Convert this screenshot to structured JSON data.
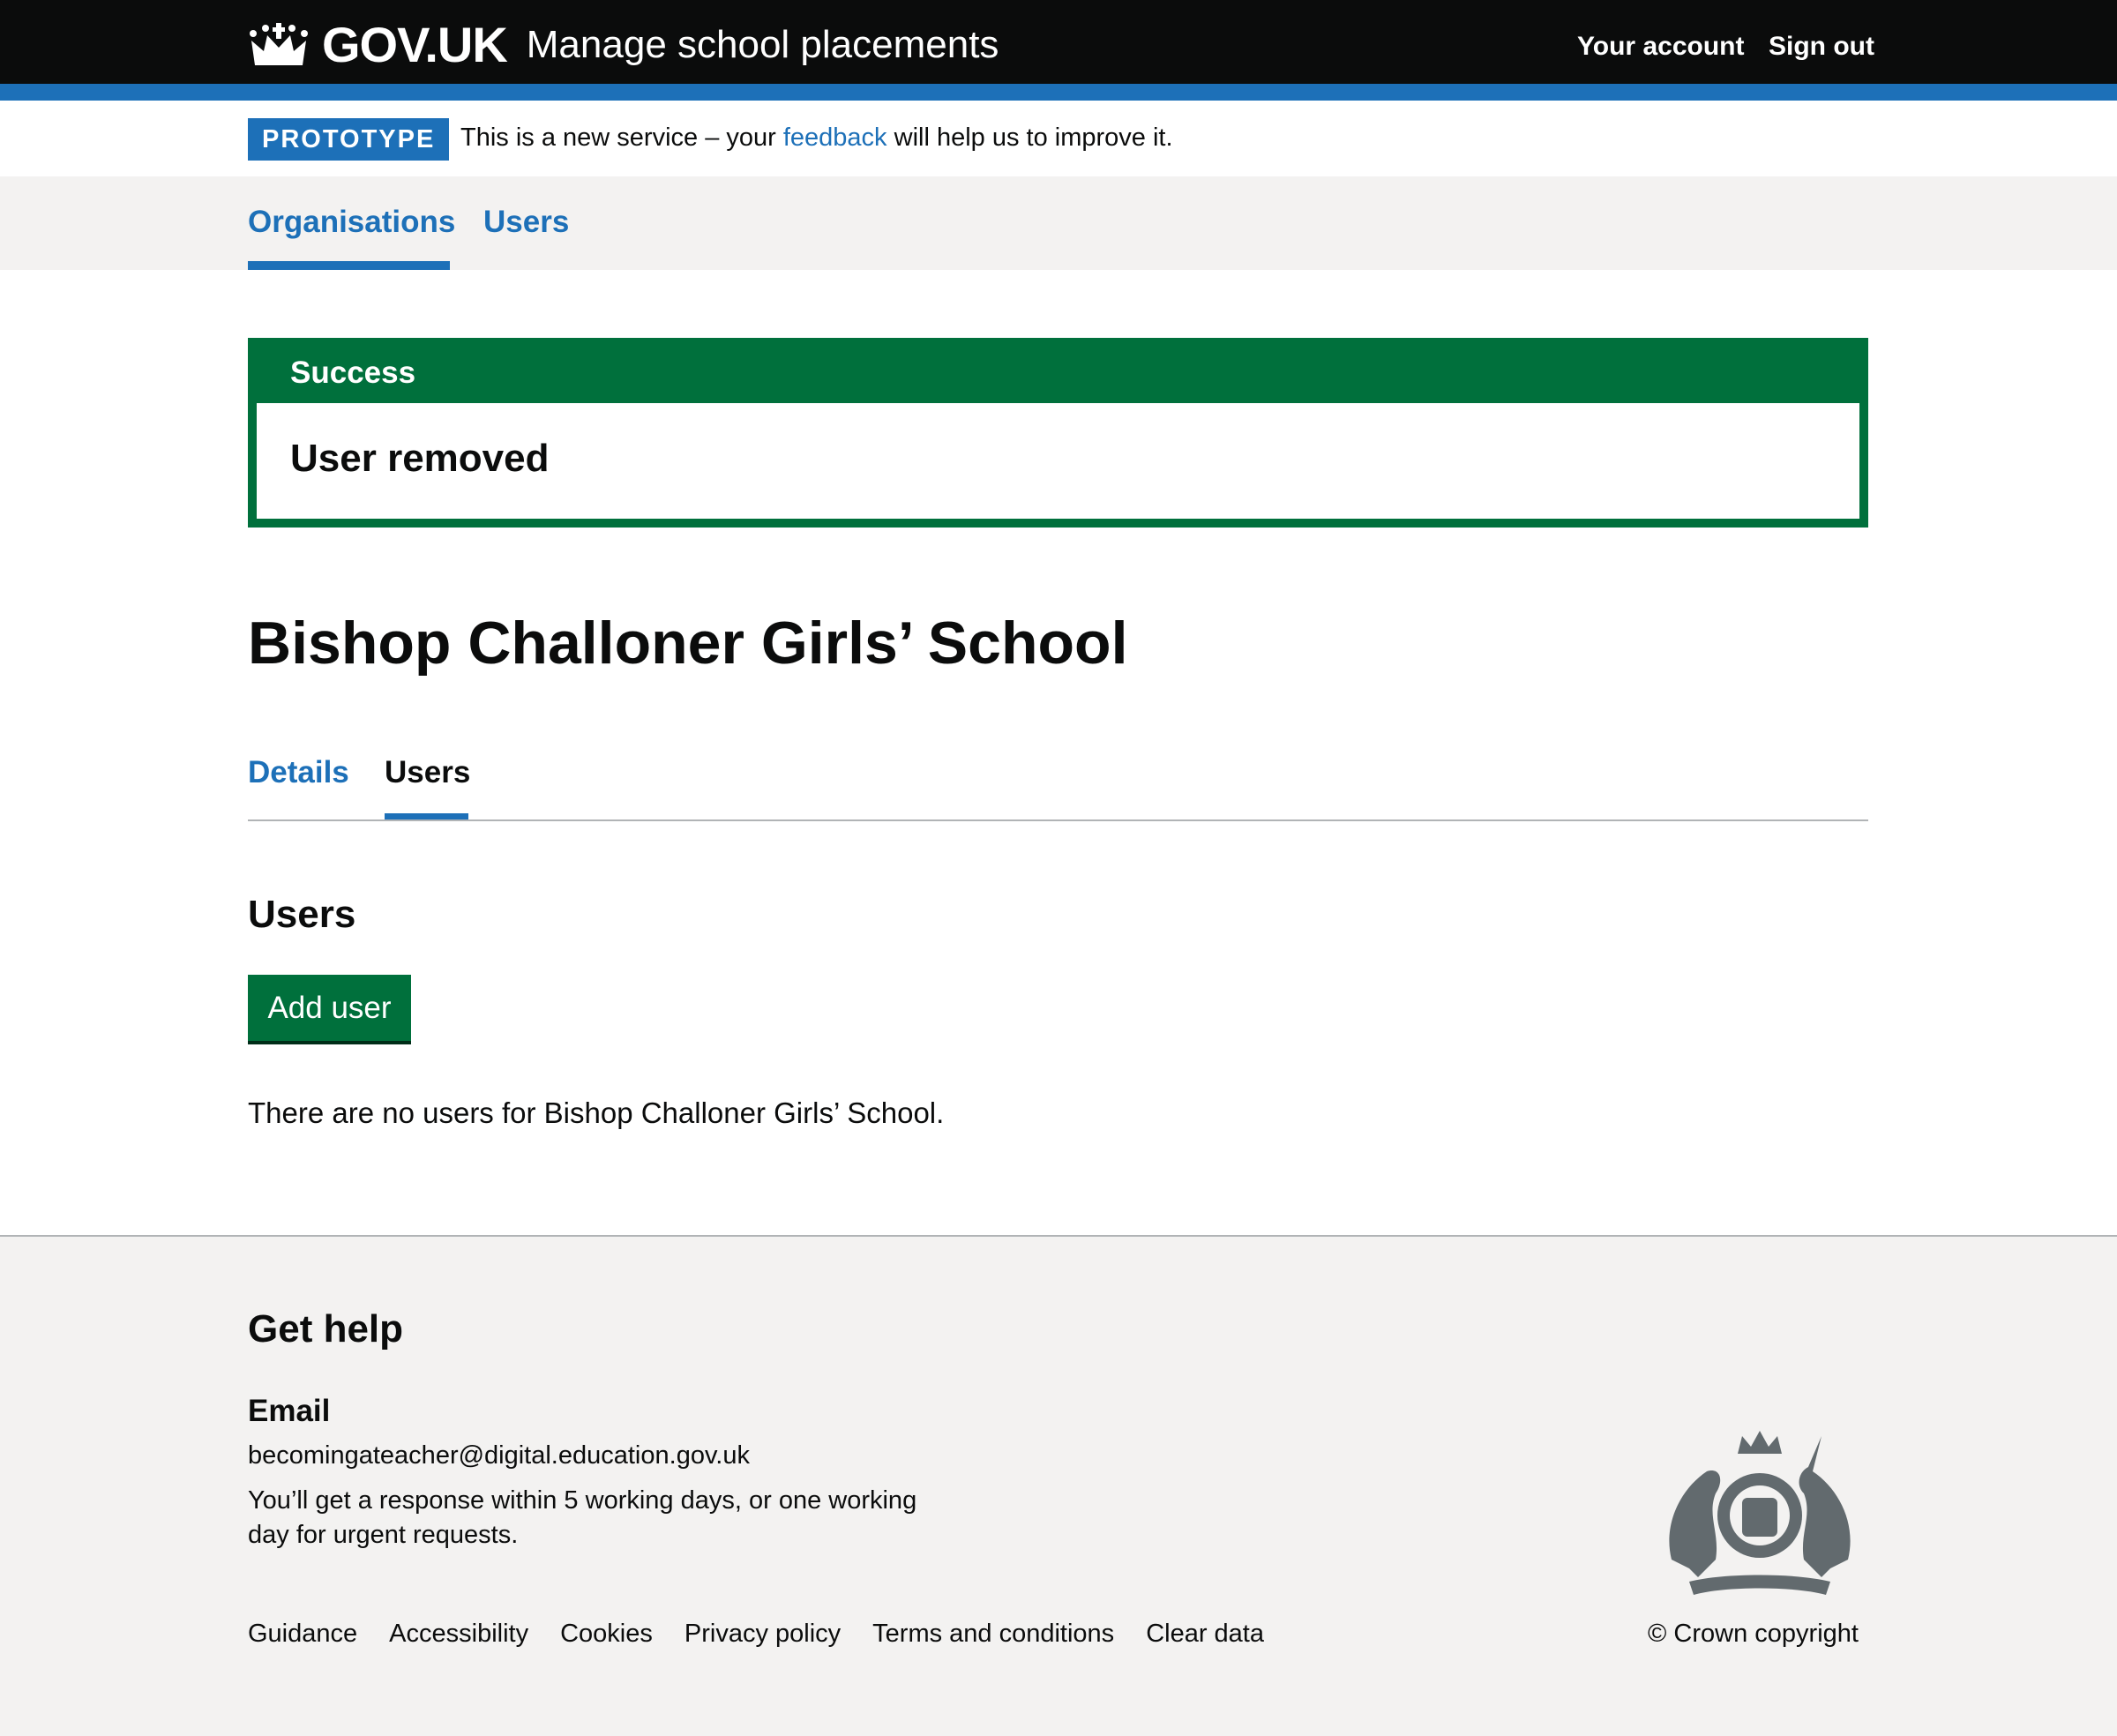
{
  "header": {
    "logo": "GOV.UK",
    "service": "Manage school placements",
    "account": "Your account",
    "signout": "Sign out"
  },
  "phase": {
    "tag": "PROTOTYPE",
    "text_before": "This is a new service – your ",
    "link": "feedback",
    "text_after": " will help us to improve it."
  },
  "nav": {
    "items": [
      {
        "label": "Organisations",
        "active": true
      },
      {
        "label": "Users",
        "active": false
      }
    ]
  },
  "banner": {
    "title": "Success",
    "message": "User removed"
  },
  "page": {
    "title": "Bishop Challoner Girls’ School",
    "tabs": [
      {
        "label": "Details"
      },
      {
        "label": "Users",
        "active": true
      }
    ],
    "section": "Users",
    "add_button": "Add user",
    "empty": "There are no users for Bishop Challoner Girls’ School."
  },
  "footer": {
    "heading": "Get help",
    "email_label": "Email",
    "email": "becomingateacher@digital.education.gov.uk",
    "response": "You’ll get a response within 5 working days, or one working day for urgent requests.",
    "links": [
      "Guidance",
      "Accessibility",
      "Cookies",
      "Privacy policy",
      "Terms and conditions",
      "Clear data"
    ],
    "copyright": "© Crown copyright"
  },
  "colors": {
    "header": "#0b0c0c",
    "brand": "#1d70b8",
    "success": "#00703c",
    "footer_bg": "#f3f2f1"
  }
}
